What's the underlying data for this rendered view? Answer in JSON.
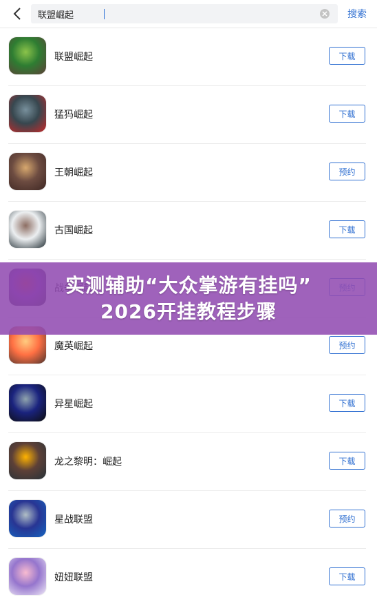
{
  "search": {
    "value": "联盟崛起",
    "button_label": "搜索"
  },
  "apps": [
    {
      "name": "联盟崛起",
      "action": "下载",
      "icon": "orc-warrior-icon",
      "colors": [
        "#2e7d32",
        "#8bc34a",
        "#5d4037"
      ]
    },
    {
      "name": "猛犸崛起",
      "action": "下载",
      "icon": "mammoth-icon",
      "colors": [
        "#37474f",
        "#78909c",
        "#c62828"
      ]
    },
    {
      "name": "王朝崛起",
      "action": "预约",
      "icon": "horseman-icon",
      "colors": [
        "#6d4c41",
        "#d7a86e",
        "#3e2723"
      ]
    },
    {
      "name": "古国崛起",
      "action": "下载",
      "icon": "general-icon",
      "colors": [
        "#eceff1",
        "#8d6e63",
        "#263238"
      ]
    },
    {
      "name": "战争崛起",
      "action": "预约",
      "icon": "war-calligraphy-icon",
      "colors": [
        "#6a1b9a",
        "#b71c1c",
        "#212121"
      ]
    },
    {
      "name": "魔英崛起",
      "action": "预约",
      "icon": "heroine-icon",
      "colors": [
        "#ff7043",
        "#ffcc80",
        "#4e342e"
      ]
    },
    {
      "name": "异星崛起",
      "action": "下载",
      "icon": "spaceship-icon",
      "colors": [
        "#1a237e",
        "#90a4ae",
        "#0d0d0d"
      ]
    },
    {
      "name": "龙之黎明：崛起",
      "action": "下载",
      "icon": "shield-warrior-icon",
      "colors": [
        "#5d4037",
        "#ffb300",
        "#263238"
      ]
    },
    {
      "name": "星战联盟",
      "action": "预约",
      "icon": "star-cannon-icon",
      "colors": [
        "#283593",
        "#b0bec5",
        "#1565c0"
      ]
    },
    {
      "name": "妞妞联盟",
      "action": "下载",
      "icon": "anime-girl-icon",
      "colors": [
        "#9575cd",
        "#f8bbd0",
        "#ede7f6"
      ]
    }
  ],
  "overlay": {
    "line1": "实测辅助“大众掌游有挂吗”",
    "line2": "2026开挂教程步骤",
    "color": "#924cb2"
  }
}
